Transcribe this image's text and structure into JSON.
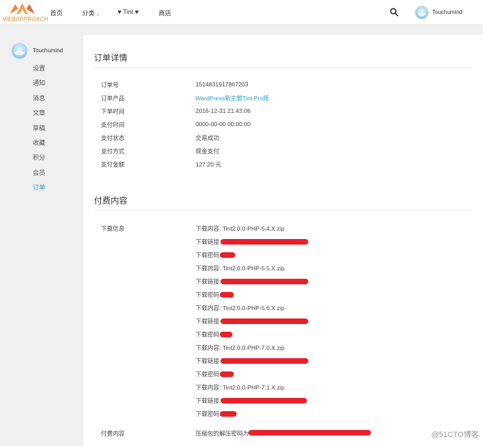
{
  "header": {
    "logo_text": "WEBAPPROACH",
    "nav": [
      {
        "label": "首页"
      },
      {
        "label": "分类"
      },
      {
        "label": "♥ Tint ♥"
      },
      {
        "label": "商店"
      }
    ],
    "user_name": "Touchumind"
  },
  "sidebar": {
    "user_name": "Touchumind",
    "items": [
      {
        "label": "设置"
      },
      {
        "label": "通知"
      },
      {
        "label": "消息"
      },
      {
        "label": "文章"
      },
      {
        "label": "草稿"
      },
      {
        "label": "收藏"
      },
      {
        "label": "积分"
      },
      {
        "label": "会员"
      },
      {
        "label": "订单"
      }
    ]
  },
  "order": {
    "title": "订单详情",
    "fields": [
      {
        "label": "订单号",
        "value": "1514831917867203"
      },
      {
        "label": "订单产品",
        "value": "WordPress新主题Tint Pro版"
      },
      {
        "label": "下单时间",
        "value": "2016-12-31 21:43:06"
      },
      {
        "label": "支付时间",
        "value": "0000-00-00 00:00:00"
      },
      {
        "label": "支付状态",
        "value": "交易成功"
      },
      {
        "label": "支付方式",
        "value": "现金支付"
      },
      {
        "label": "支付金额",
        "value": "127.20 元"
      }
    ]
  },
  "paid": {
    "title": "付费内容",
    "download_label": "下载信息",
    "downloads": [
      {
        "content": "下载内容: Tint2.0.0-PHP-5.4.X.zip",
        "link_label": "下载链接:",
        "password_label": "下载密码:"
      },
      {
        "content": "下载内容: Tint2.0.0-PHP-5.5.X.zip",
        "link_label": "下载链接:",
        "password_label": "下载密码:"
      },
      {
        "content": "下载内容: Tint2.0.0-PHP-5.6.X.zip",
        "link_label": "下载链接:",
        "password_label": "下载密码:"
      },
      {
        "content": "下载内容: Tint2.0.0-PHP-7.0.X.zip",
        "link_label": "下载链接:",
        "password_label": "下载密码:"
      },
      {
        "content": "下载内容: Tint2.0.0-PHP-7.1.X.zip",
        "link_label": "下载链接:",
        "password_label": "下载密码:"
      }
    ],
    "paid_content_label": "付费内容",
    "paid_content_value": "压缩包的解压密码为"
  },
  "watermark": "@51CTO博客",
  "colors": {
    "accent": "#2a9ad6",
    "redaction": "#e8202a",
    "logo": "#e08a3a"
  }
}
